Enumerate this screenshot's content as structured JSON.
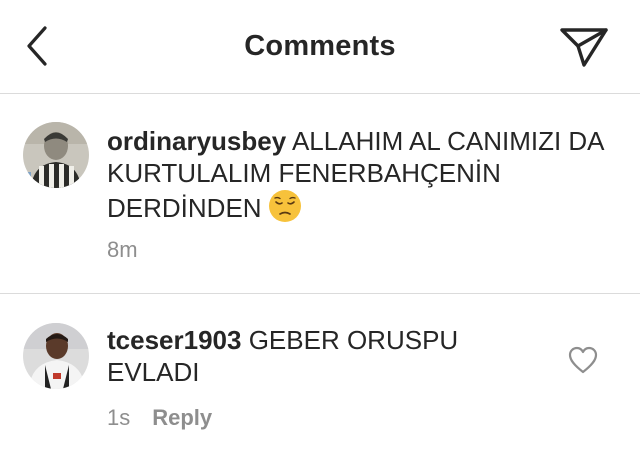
{
  "header": {
    "title": "Comments",
    "back_icon": "chevron-left-icon",
    "share_icon": "paper-plane-icon"
  },
  "comments": [
    {
      "username": "ordinaryusbey",
      "text": "ALLAHIM AL CANIMIZI DA KURTULALIM FENERBAHÇENİN DERDİNDEN",
      "emoji": "pensive-face-emoji",
      "time": "8m"
    },
    {
      "username": "tceser1903",
      "text": "GEBER ORUSPU EVLADI",
      "time": "1s",
      "reply_label": "Reply",
      "like_icon": "heart-outline-icon"
    }
  ],
  "colors": {
    "text": "#262626",
    "secondary": "#8e8e8e",
    "divider": "#dbdbdb",
    "background": "#ffffff"
  }
}
